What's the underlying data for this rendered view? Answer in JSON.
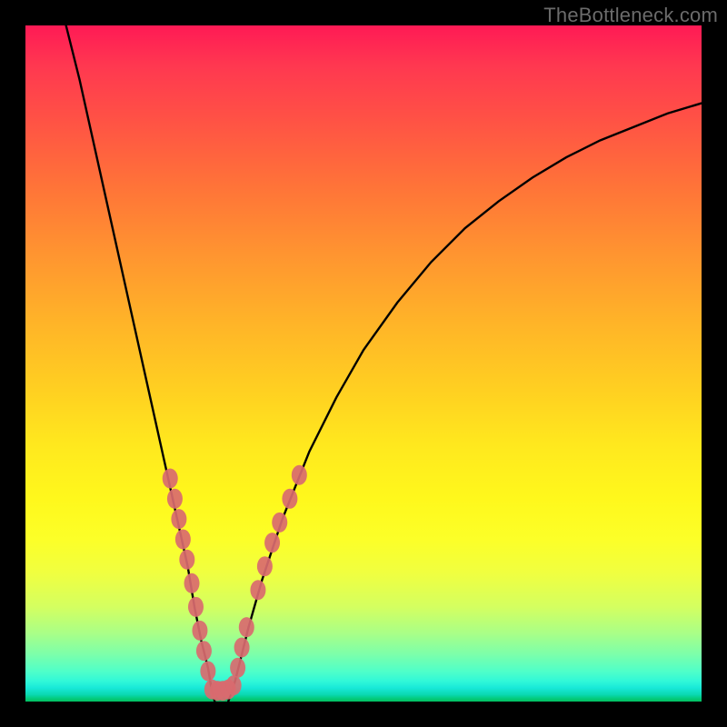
{
  "watermark": "TheBottleneck.com",
  "chart_data": {
    "type": "line",
    "title": "",
    "xlabel": "",
    "ylabel": "",
    "xlim": [
      0,
      100
    ],
    "ylim": [
      0,
      100
    ],
    "grid": false,
    "legend": false,
    "background_gradient": {
      "top_color": "#ff1a55",
      "mid_color": "#ffe000",
      "bottom_color": "#02c060"
    },
    "series": [
      {
        "name": "left-branch",
        "color": "#000000",
        "x": [
          6,
          8,
          10,
          12,
          14,
          16,
          18,
          20,
          22,
          24,
          25,
          26,
          27,
          27.5,
          28
        ],
        "y": [
          100,
          92,
          83,
          74,
          65,
          56,
          47,
          38,
          29,
          20,
          14,
          9,
          5,
          2,
          0
        ]
      },
      {
        "name": "right-branch",
        "color": "#000000",
        "x": [
          30,
          31,
          32,
          33,
          35,
          38,
          42,
          46,
          50,
          55,
          60,
          65,
          70,
          75,
          80,
          85,
          90,
          95,
          100
        ],
        "y": [
          0,
          3,
          7,
          11,
          18,
          27,
          37,
          45,
          52,
          59,
          65,
          70,
          74,
          77.5,
          80.5,
          83,
          85,
          87,
          88.5
        ]
      }
    ],
    "markers": [
      {
        "name": "left-cluster",
        "color": "#d96a6f",
        "points": [
          {
            "x": 21.4,
            "y": 33.0
          },
          {
            "x": 22.1,
            "y": 30.0
          },
          {
            "x": 22.7,
            "y": 27.0
          },
          {
            "x": 23.3,
            "y": 24.0
          },
          {
            "x": 23.9,
            "y": 21.0
          },
          {
            "x": 24.6,
            "y": 17.5
          },
          {
            "x": 25.2,
            "y": 14.0
          },
          {
            "x": 25.8,
            "y": 10.5
          },
          {
            "x": 26.4,
            "y": 7.5
          },
          {
            "x": 27.0,
            "y": 4.5
          }
        ]
      },
      {
        "name": "right-cluster",
        "color": "#d96a6f",
        "points": [
          {
            "x": 31.4,
            "y": 5.0
          },
          {
            "x": 32.0,
            "y": 8.0
          },
          {
            "x": 32.7,
            "y": 11.0
          },
          {
            "x": 34.4,
            "y": 16.5
          },
          {
            "x": 35.4,
            "y": 20.0
          },
          {
            "x": 36.5,
            "y": 23.5
          },
          {
            "x": 37.6,
            "y": 26.5
          },
          {
            "x": 39.1,
            "y": 30.0
          },
          {
            "x": 40.5,
            "y": 33.5
          }
        ]
      },
      {
        "name": "bottom-cluster",
        "color": "#d96a6f",
        "points": [
          {
            "x": 27.6,
            "y": 1.8
          },
          {
            "x": 28.4,
            "y": 1.6
          },
          {
            "x": 29.2,
            "y": 1.6
          },
          {
            "x": 30.0,
            "y": 1.8
          },
          {
            "x": 30.8,
            "y": 2.4
          }
        ]
      }
    ]
  }
}
